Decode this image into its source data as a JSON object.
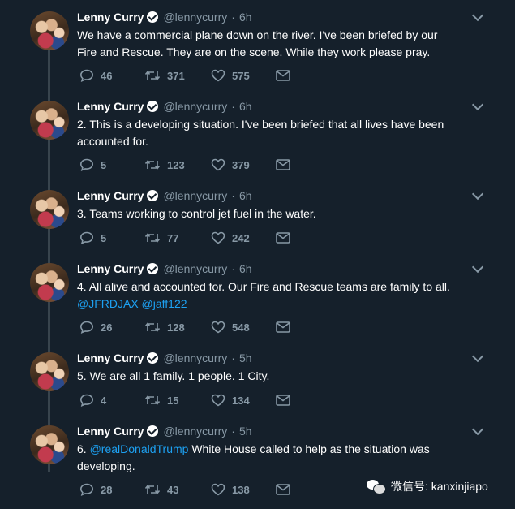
{
  "tweets": [
    {
      "name": "Lenny Curry",
      "handle": "@lennycurry",
      "time": "6h",
      "parts": [
        "We have a commercial plane down on the river.  I've been briefed by our Fire and Rescue. They are on the scene.  While they work please pray."
      ],
      "replies": "46",
      "retweets": "371",
      "likes": "575"
    },
    {
      "name": "Lenny Curry",
      "handle": "@lennycurry",
      "time": "6h",
      "parts": [
        "2. This is a developing situation. I've been briefed that all lives have been accounted for."
      ],
      "replies": "5",
      "retweets": "123",
      "likes": "379"
    },
    {
      "name": "Lenny Curry",
      "handle": "@lennycurry",
      "time": "6h",
      "parts": [
        "3.  Teams working to control jet fuel in the water."
      ],
      "replies": "5",
      "retweets": "77",
      "likes": "242"
    },
    {
      "name": "Lenny Curry",
      "handle": "@lennycurry",
      "time": "6h",
      "parts": [
        "4.  All alive and accounted for. Our Fire and Rescue teams are family to all.",
        "@JFRDJAX @jaff122"
      ],
      "replies": "26",
      "retweets": "128",
      "likes": "548"
    },
    {
      "name": "Lenny Curry",
      "handle": "@lennycurry",
      "time": "5h",
      "parts": [
        "5. We are all 1 family. 1 people. 1 City."
      ],
      "replies": "4",
      "retweets": "15",
      "likes": "134"
    },
    {
      "name": "Lenny Curry",
      "handle": "@lennycurry",
      "time": "5h",
      "parts": [
        "6. ",
        "@realDonaldTrump",
        " White House called to help as the situation was developing."
      ],
      "replies": "28",
      "retweets": "43",
      "likes": "138"
    }
  ],
  "separator": "·",
  "icons": {
    "reply": "reply-icon",
    "retweet": "retweet-icon",
    "like": "heart-icon",
    "dm": "envelope-icon",
    "menu": "chevron-down-icon",
    "verified": "verified-badge-icon"
  },
  "watermark": {
    "text": "微信号: kanxinjiapo"
  },
  "colors": {
    "background": "#15202b",
    "text": "#ffffff",
    "secondary": "#8899a6",
    "link": "#1da1f2",
    "thread_line": "#38444d"
  }
}
